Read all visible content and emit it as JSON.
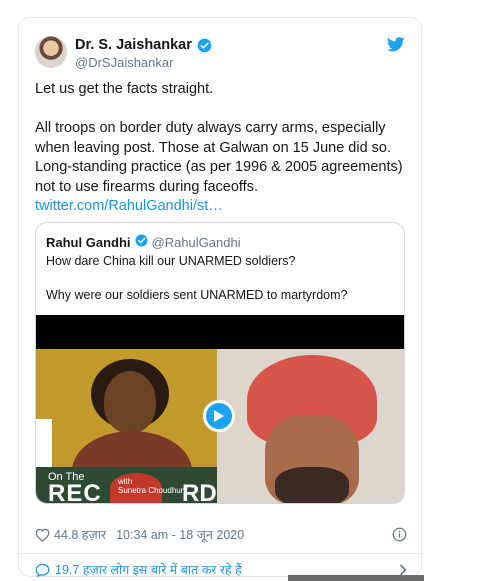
{
  "author": {
    "name": "Dr. S. Jaishankar",
    "handle": "@DrSJaishankar"
  },
  "tweet": {
    "line1": "Let us get the facts straight.",
    "para2": "All troops on border duty always carry arms, especially when leaving post. Those at Galwan on 15 June did so. Long-standing practice (as per 1996 & 2005 agreements) not to use firearms during faceoffs.",
    "link": "twitter.com/RahulGandhi/st…"
  },
  "quoted": {
    "name": "Rahul Gandhi",
    "handle": "@RahulGandhi",
    "line1": "How dare China kill our UNARMED soldiers?",
    "line2": "Why were our soldiers sent UNARMED to martyrdom?",
    "video_overlay": {
      "on_the": "On The",
      "rec": "REC",
      "rd": "RD",
      "with": "with",
      "host": "Sunetra Choudhury"
    }
  },
  "meta": {
    "likes": "44.8 हज़ार",
    "timestamp": "10:34 am - 18 जून 2020"
  },
  "conversation": {
    "text": "19.7 हज़ार लोग इस बारे में बात कर रहे हैं"
  },
  "colors": {
    "accent": "#1da1f2",
    "link": "#1b95e0",
    "muted": "#657786"
  }
}
